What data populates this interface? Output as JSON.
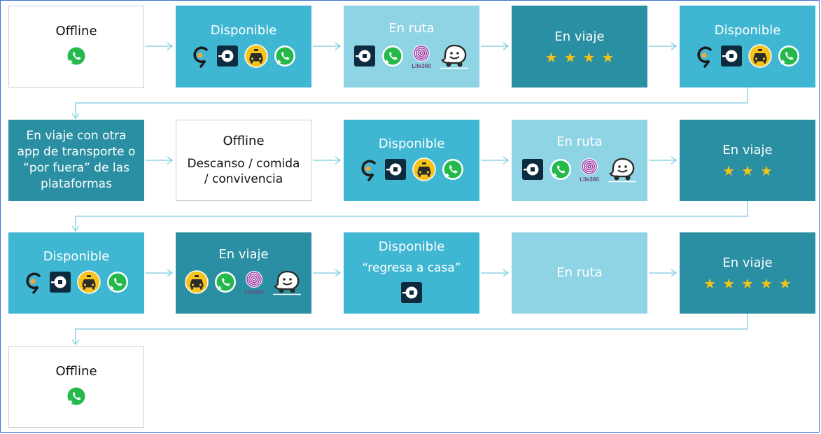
{
  "boxes": {
    "r1c1": {
      "title": "Offline"
    },
    "r1c2": {
      "title": "Disponible"
    },
    "r1c3": {
      "title": "En ruta"
    },
    "r1c4": {
      "title": "En viaje"
    },
    "r1c5": {
      "title": "Disponible"
    },
    "r2c1": {
      "lines": [
        "En viaje con otra",
        "app de transporte o",
        "“por fuera” de las",
        "plataformas"
      ]
    },
    "r2c2": {
      "title": "Offline",
      "subtitle_lines": [
        "Descanso / comida",
        "/ convivencia"
      ]
    },
    "r2c3": {
      "title": "Disponible"
    },
    "r2c4": {
      "title": "En ruta"
    },
    "r2c5": {
      "title": "En viaje"
    },
    "r3c1": {
      "title": "Disponible"
    },
    "r3c2": {
      "title": "En viaje"
    },
    "r3c3": {
      "title": "Disponible",
      "subtitle": "“regresa a casa”"
    },
    "r3c4": {
      "title": "En ruta"
    },
    "r3c5": {
      "title": "En viaje"
    },
    "r4c1": {
      "title": "Offline"
    }
  },
  "icons": {
    "r1c1": [
      "whatsapp-icon"
    ],
    "r1c2": [
      "cabify-icon",
      "uber-icon",
      "easy-taxi-icon",
      "whatsapp-icon"
    ],
    "r1c3": [
      "uber-icon",
      "whatsapp-icon",
      "life360-icon",
      "waze-icon"
    ],
    "r1c5": [
      "cabify-icon",
      "uber-icon",
      "easy-taxi-icon",
      "whatsapp-icon"
    ],
    "r2c3": [
      "cabify-icon",
      "uber-icon",
      "easy-taxi-icon",
      "whatsapp-icon"
    ],
    "r2c4": [
      "uber-icon",
      "whatsapp-icon",
      "life360-icon",
      "waze-icon"
    ],
    "r3c1": [
      "cabify-icon",
      "uber-icon",
      "easy-taxi-icon",
      "whatsapp-icon"
    ],
    "r3c2": [
      "easy-taxi-icon",
      "whatsapp-icon",
      "life360-icon",
      "waze-icon"
    ],
    "r3c3": [
      "uber-icon"
    ],
    "r4c1": [
      "whatsapp-icon"
    ]
  },
  "life360_label": "Life360",
  "ratings": {
    "r1c4": 4,
    "r2c5": 3,
    "r3c5": 5
  },
  "colors": {
    "dark_teal": "#2a8fa2",
    "medium_teal": "#3fb6d2",
    "light_teal": "#8fd4e4",
    "star_yellow": "#f3c316",
    "whatsapp_green": "#25b84a",
    "connector": "#8fd4e4"
  }
}
